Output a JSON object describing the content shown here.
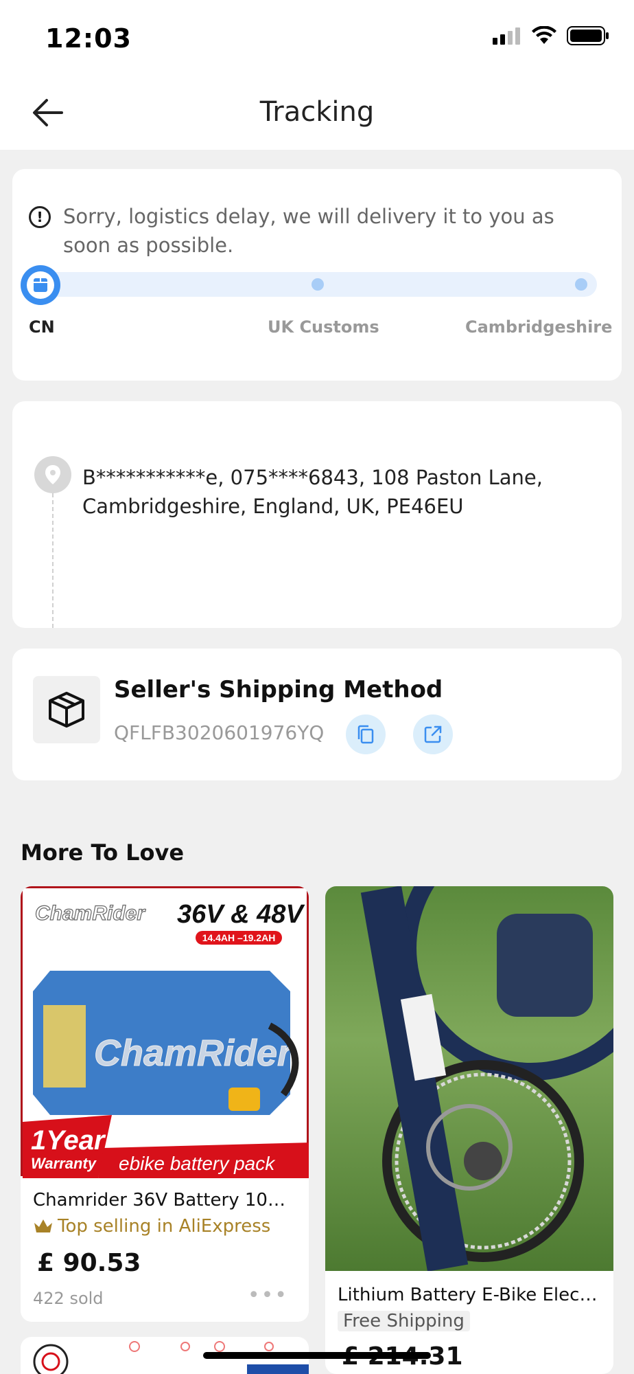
{
  "status_bar": {
    "time": "12:03"
  },
  "nav": {
    "title": "Tracking"
  },
  "tracking": {
    "notice": "Sorry, logistics delay, we will delivery it to you as soon as possible.",
    "steps": [
      "CN",
      "UK Customs",
      "Cambridgeshire"
    ],
    "active_step": 0,
    "accent_color": "#3a8ef0"
  },
  "address": {
    "text": "B***********e,  075****6843,  108 Paston Lane,  Cambridgeshire,  England,  UK,  PE46EU"
  },
  "shipping": {
    "title": "Seller's Shipping Method",
    "tracking_number": "QFLFB3020601976YQ"
  },
  "more_to_love": {
    "title": "More To Love",
    "products": [
      {
        "name": "Chamrider 36V Battery 10A...",
        "badge": "Top selling in AliExpress",
        "price": "£ 90.53",
        "sold": "422 sold",
        "image_text": {
          "brand": "ChamRider",
          "voltage": "36V & 48V",
          "capacity": "14.4AH –19.2AH",
          "warranty_big": "1Year",
          "warranty_small": "Warranty",
          "pack_label": "ebike battery pack"
        }
      },
      {
        "name": "Lithium Battery E-Bike Electr...",
        "shipping": "Free Shipping",
        "price": "£ 214.31"
      }
    ]
  }
}
